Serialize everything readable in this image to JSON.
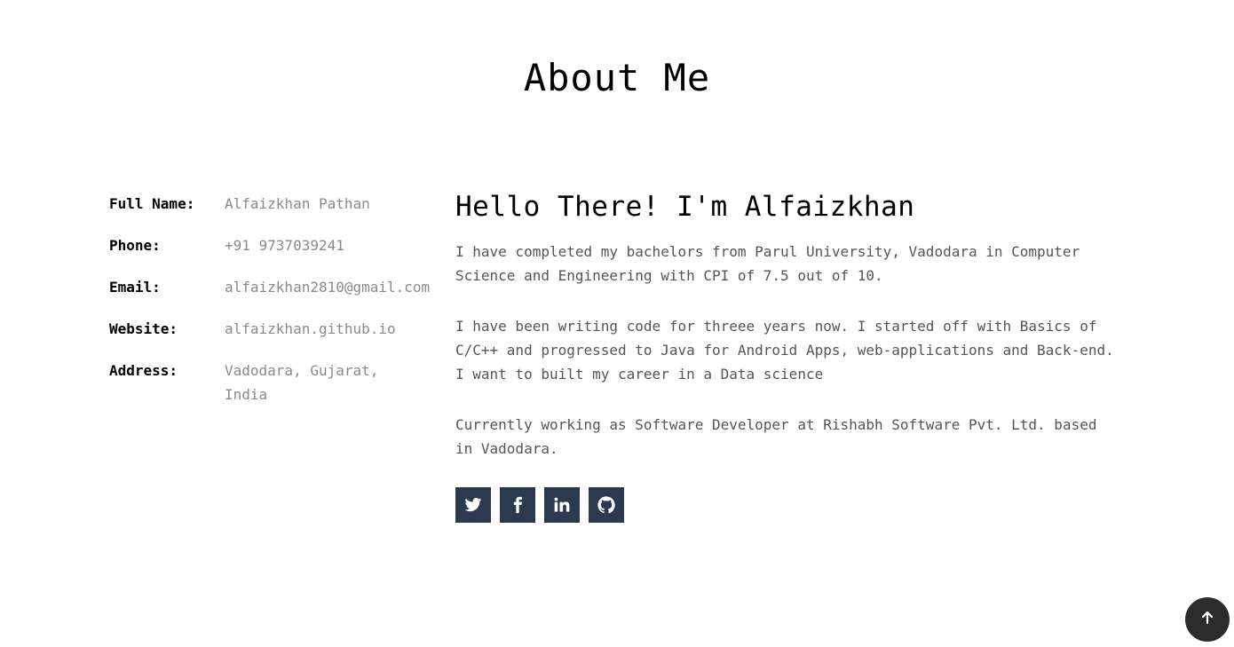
{
  "section": {
    "title": "About Me"
  },
  "info": [
    {
      "label": "Full Name:",
      "value": "Alfaizkhan Pathan"
    },
    {
      "label": "Phone:",
      "value": "+91 9737039241"
    },
    {
      "label": "Email:",
      "value": "alfaizkhan2810@gmail.com"
    },
    {
      "label": "Website:",
      "value": "alfaizkhan.github.io"
    },
    {
      "label": "Address:",
      "value": "Vadodara, Gujarat, India"
    }
  ],
  "bio": {
    "heading": "Hello There! I'm Alfaizkhan",
    "paragraphs": [
      "I have completed my bachelors from Parul University, Vadodara in Computer Science and Engineering with CPI of 7.5 out of 10.",
      "I have been writing code for threee years now. I started off with Basics of C/C++ and progressed to Java for Android Apps, web-applications and Back-end. I want to built my career in a Data science",
      "Currently working as Software Developer at Rishabh Software Pvt. Ltd. based in Vadodara."
    ]
  },
  "social": [
    {
      "icon": "twitter-icon"
    },
    {
      "icon": "facebook-icon"
    },
    {
      "icon": "linkedin-icon"
    },
    {
      "icon": "github-icon"
    }
  ],
  "back_to_top": {
    "icon": "arrow-up-icon"
  },
  "colors": {
    "social_bg": "#2b3a4f",
    "back_to_top_bg": "#2b2b2b",
    "value_text": "#8a8a8a",
    "body_text": "#555555"
  }
}
